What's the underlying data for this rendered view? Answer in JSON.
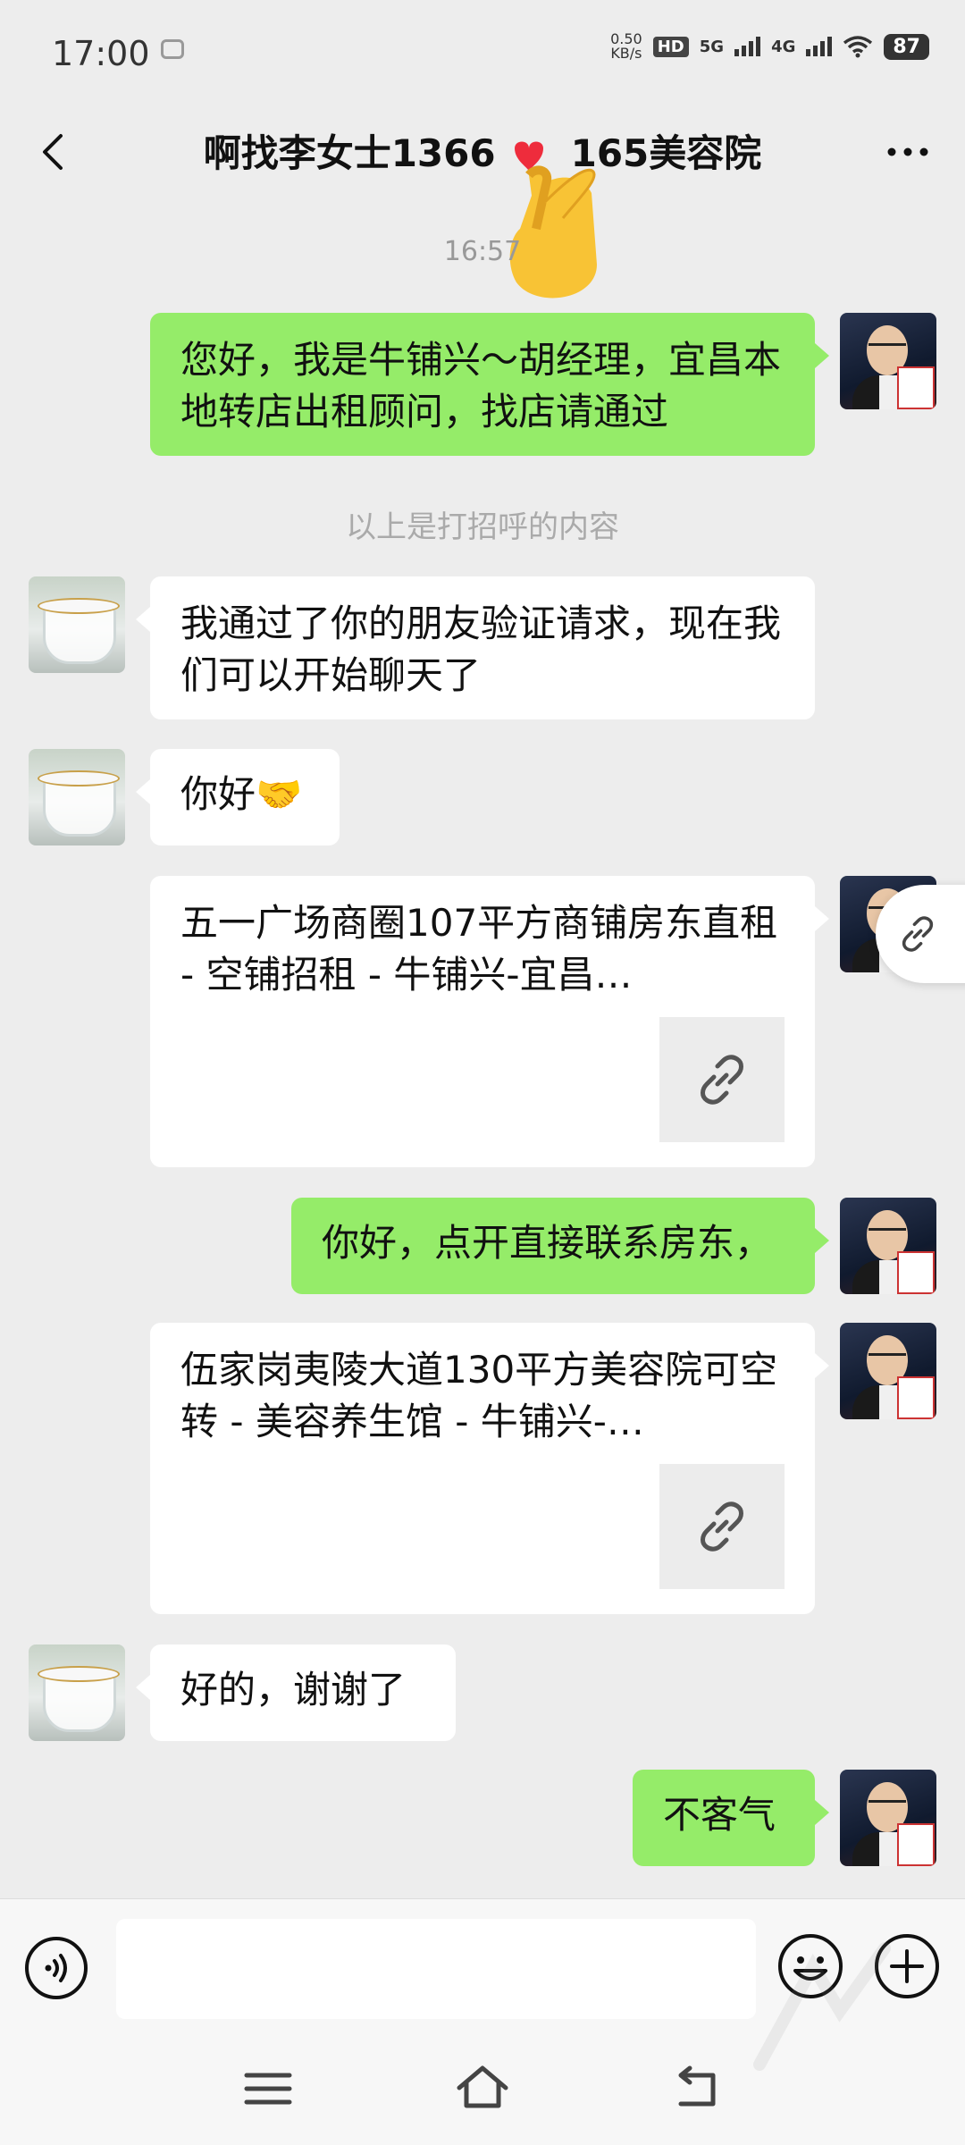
{
  "status_bar": {
    "time": "17:00",
    "net_speed_value": "0.50",
    "net_speed_unit": "KB/s",
    "hd_label": "HD",
    "sim1_label": "5G",
    "sim2_label": "4G",
    "battery": "87"
  },
  "header": {
    "title": "啊找李女士1366  165美容院"
  },
  "messages": [
    {
      "type": "timestamp",
      "text": "16:57"
    },
    {
      "type": "text",
      "side": "out",
      "text": "您好，我是牛铺兴～胡经理，宜昌本地转店出租顾问，找店请通过"
    },
    {
      "type": "system",
      "text": "以上是打招呼的内容"
    },
    {
      "type": "text",
      "side": "in",
      "text": "我通过了你的朋友验证请求，现在我们可以开始聊天了"
    },
    {
      "type": "text",
      "side": "in",
      "text": "你好🤝"
    },
    {
      "type": "link_card",
      "side": "out",
      "text": "五一广场商圈107平方商铺房东直租 - 空铺招租 - 牛铺兴-宜昌…",
      "thumb_icon": "link-icon"
    },
    {
      "type": "text",
      "side": "out",
      "text": "你好，点开直接联系房东，"
    },
    {
      "type": "link_card",
      "side": "out",
      "text": "伍家岗夷陵大道130平方美容院可空转 - 美容养生馆 - 牛铺兴-…",
      "thumb_icon": "link-icon"
    },
    {
      "type": "text",
      "side": "in",
      "text": "好的，谢谢了"
    },
    {
      "type": "text",
      "side": "out",
      "text": "不客气"
    }
  ],
  "input_bar": {
    "placeholder": "",
    "voice_icon": "voice-icon",
    "emoji_icon": "emoji-icon",
    "plus_icon": "plus-icon"
  },
  "colors": {
    "outgoing_bubble": "#95ec69",
    "incoming_bubble": "#ffffff",
    "background": "#ededed"
  }
}
